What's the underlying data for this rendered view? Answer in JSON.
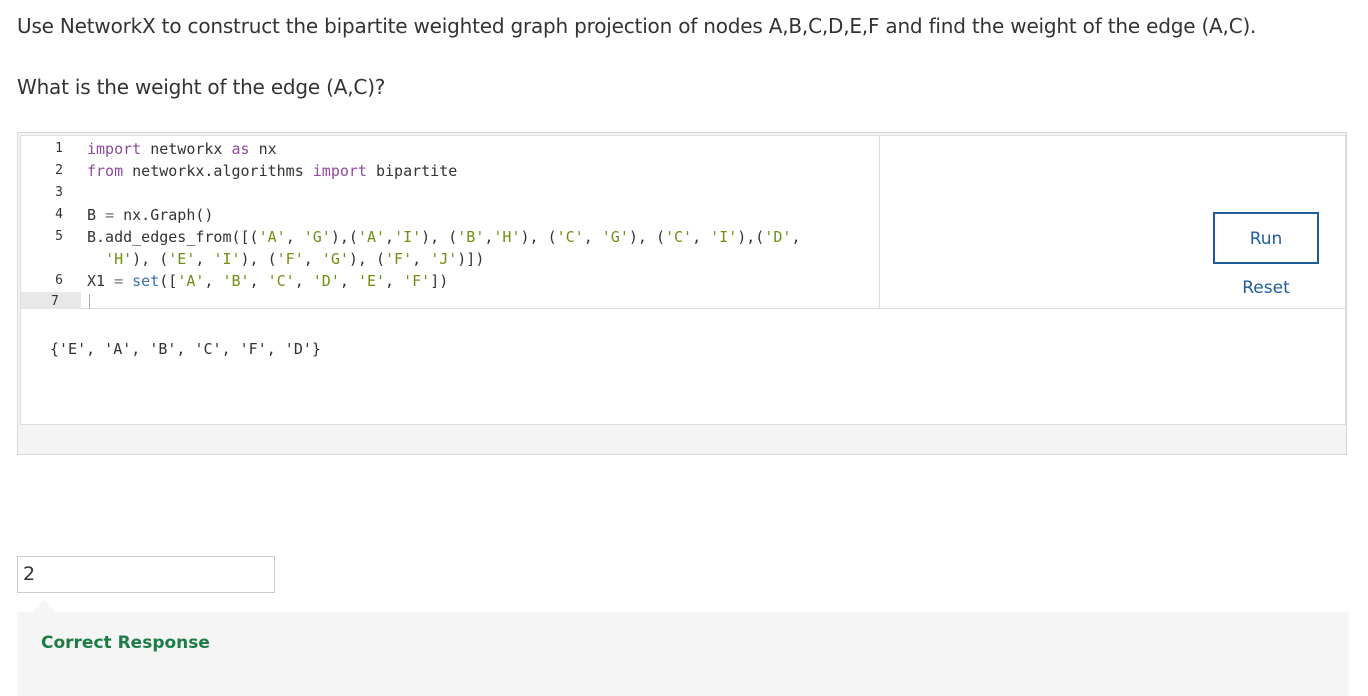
{
  "question": {
    "text": "Use NetworkX to construct the bipartite weighted graph projection of nodes A,B,C,D,E,F and find the weight of the edge (A,C).",
    "prompt": "What is the weight of the edge (A,C)?"
  },
  "editor": {
    "line_numbers": [
      "1",
      "2",
      "3",
      "4",
      "5",
      "6",
      "7"
    ],
    "active_line": "7",
    "lines": [
      [
        {
          "t": "import",
          "c": "kw"
        },
        {
          "t": " networkx ",
          "c": ""
        },
        {
          "t": "as",
          "c": "kw"
        },
        {
          "t": " nx",
          "c": ""
        }
      ],
      [
        {
          "t": "from",
          "c": "kw"
        },
        {
          "t": " networkx.algorithms ",
          "c": ""
        },
        {
          "t": "import",
          "c": "kw"
        },
        {
          "t": " bipartite",
          "c": ""
        }
      ],
      [],
      [
        {
          "t": "B ",
          "c": ""
        },
        {
          "t": "=",
          "c": "op"
        },
        {
          "t": " nx.Graph()",
          "c": ""
        }
      ],
      [
        {
          "t": "B.add_edges_from([(",
          "c": ""
        },
        {
          "t": "'A'",
          "c": "str"
        },
        {
          "t": ", ",
          "c": ""
        },
        {
          "t": "'G'",
          "c": "str"
        },
        {
          "t": "),(",
          "c": ""
        },
        {
          "t": "'A'",
          "c": "str"
        },
        {
          "t": ",",
          "c": ""
        },
        {
          "t": "'I'",
          "c": "str"
        },
        {
          "t": "), (",
          "c": ""
        },
        {
          "t": "'B'",
          "c": "str"
        },
        {
          "t": ",",
          "c": ""
        },
        {
          "t": "'H'",
          "c": "str"
        },
        {
          "t": "), (",
          "c": ""
        },
        {
          "t": "'C'",
          "c": "str"
        },
        {
          "t": ", ",
          "c": ""
        },
        {
          "t": "'G'",
          "c": "str"
        },
        {
          "t": "), (",
          "c": ""
        },
        {
          "t": "'C'",
          "c": "str"
        },
        {
          "t": ", ",
          "c": ""
        },
        {
          "t": "'I'",
          "c": "str"
        },
        {
          "t": "),(",
          "c": ""
        },
        {
          "t": "'D'",
          "c": "str"
        },
        {
          "t": ",",
          "c": ""
        }
      ],
      [
        {
          "t": "  ",
          "c": ""
        },
        {
          "t": "'H'",
          "c": "str"
        },
        {
          "t": "), (",
          "c": ""
        },
        {
          "t": "'E'",
          "c": "str"
        },
        {
          "t": ", ",
          "c": ""
        },
        {
          "t": "'I'",
          "c": "str"
        },
        {
          "t": "), (",
          "c": ""
        },
        {
          "t": "'F'",
          "c": "str"
        },
        {
          "t": ", ",
          "c": ""
        },
        {
          "t": "'G'",
          "c": "str"
        },
        {
          "t": "), (",
          "c": ""
        },
        {
          "t": "'F'",
          "c": "str"
        },
        {
          "t": ", ",
          "c": ""
        },
        {
          "t": "'J'",
          "c": "str"
        },
        {
          "t": ")])",
          "c": ""
        }
      ],
      [
        {
          "t": "X1 ",
          "c": ""
        },
        {
          "t": "=",
          "c": "op"
        },
        {
          "t": " ",
          "c": ""
        },
        {
          "t": "set",
          "c": "fn"
        },
        {
          "t": "([",
          "c": ""
        },
        {
          "t": "'A'",
          "c": "str"
        },
        {
          "t": ", ",
          "c": ""
        },
        {
          "t": "'B'",
          "c": "str"
        },
        {
          "t": ", ",
          "c": ""
        },
        {
          "t": "'C'",
          "c": "str"
        },
        {
          "t": ", ",
          "c": ""
        },
        {
          "t": "'D'",
          "c": "str"
        },
        {
          "t": ", ",
          "c": ""
        },
        {
          "t": "'E'",
          "c": "str"
        },
        {
          "t": ", ",
          "c": ""
        },
        {
          "t": "'F'",
          "c": "str"
        },
        {
          "t": "])",
          "c": ""
        }
      ]
    ]
  },
  "controls": {
    "run_label": "Run",
    "reset_label": "Reset"
  },
  "output": {
    "text": "{'E', 'A', 'B', 'C', 'F', 'D'}"
  },
  "answer": {
    "value": "2"
  },
  "feedback": {
    "text": "Correct Response",
    "color": "#1c7c45"
  }
}
